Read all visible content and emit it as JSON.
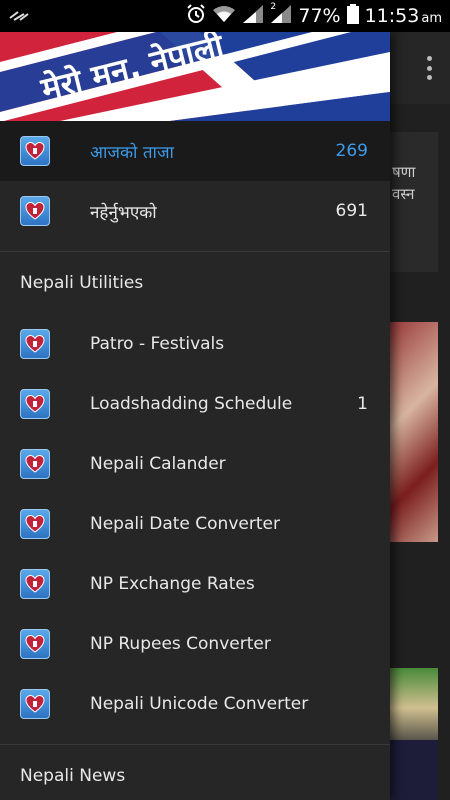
{
  "status_bar": {
    "battery": "77%",
    "time": "11:53",
    "ampm": "am",
    "sim_label": "2"
  },
  "header": {
    "banner_text": "मेरो मन, नेपाली"
  },
  "background": {
    "partial_text_1": "षणा",
    "partial_text_2": "वस्न"
  },
  "drawer": {
    "top_items": [
      {
        "label": "आजको ताजा",
        "count": "269",
        "selected": true
      },
      {
        "label": "नहेर्नुभएको",
        "count": "691",
        "selected": false
      }
    ],
    "utilities_section": {
      "title": "Nepali Utilities",
      "items": [
        {
          "label": "Patro - Festivals",
          "count": ""
        },
        {
          "label": "Loadshadding Schedule",
          "count": "1"
        },
        {
          "label": "Nepali Calander",
          "count": ""
        },
        {
          "label": "Nepali Date Converter",
          "count": ""
        },
        {
          "label": "NP Exchange Rates",
          "count": ""
        },
        {
          "label": "NP Rupees Converter",
          "count": ""
        },
        {
          "label": "Nepali Unicode Converter",
          "count": ""
        }
      ]
    },
    "news_section": {
      "title": "Nepali News"
    }
  },
  "colors": {
    "accent": "#3d9be9",
    "drawer_bg": "#262626",
    "selected_bg": "#1a1a1a",
    "banner_red": "#d2233c",
    "banner_blue": "#1f3f9a"
  }
}
